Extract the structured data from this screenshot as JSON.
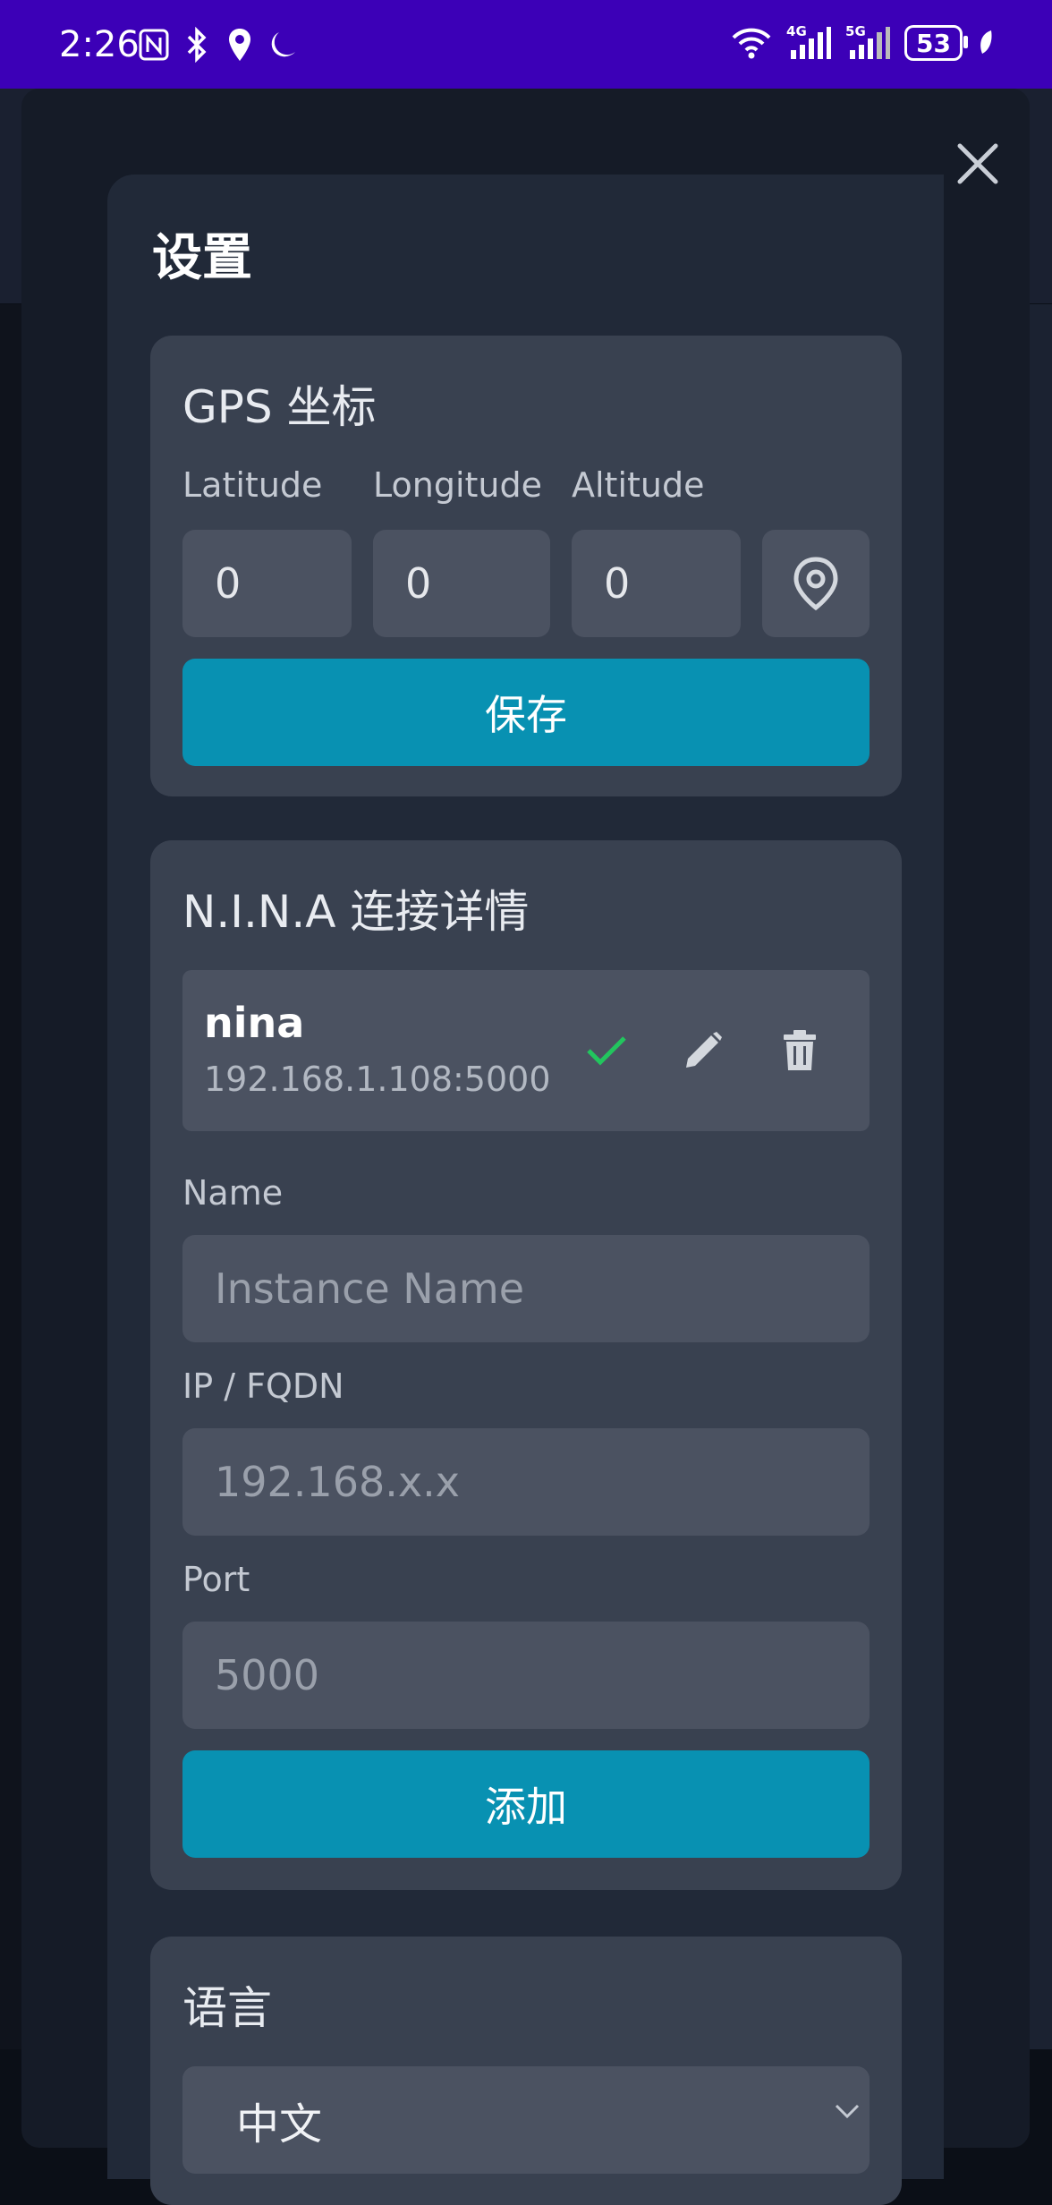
{
  "status_bar": {
    "time": "2:26",
    "battery": "53",
    "net_4g": "4G",
    "net_5g": "5G"
  },
  "modal": {
    "title": "设置",
    "gps": {
      "title": "GPS 坐标",
      "latitude_label": "Latitude",
      "longitude_label": "Longitude",
      "altitude_label": "Altitude",
      "latitude_value": "0",
      "longitude_value": "0",
      "altitude_value": "0",
      "save_label": "保存"
    },
    "nina": {
      "title": "N.I.N.A 连接详情",
      "connections": [
        {
          "name": "nina",
          "address": "192.168.1.108:5000"
        }
      ],
      "name_label": "Name",
      "name_placeholder": "Instance Name",
      "ip_label": "IP / FQDN",
      "ip_placeholder": "192.168.x.x",
      "port_label": "Port",
      "port_placeholder": "5000",
      "add_label": "添加"
    },
    "language": {
      "title": "语言",
      "selected": "中文"
    }
  },
  "colors": {
    "status_bar": "#3c00b7",
    "modal_bg": "#212938",
    "card_bg": "#394150",
    "field_bg": "#4b5261",
    "primary": "#0891b2",
    "check": "#22c55e"
  },
  "icons": [
    "wifi-icon",
    "signal-icon",
    "nfc-icon",
    "bluetooth-icon",
    "location-icon",
    "moon-icon",
    "close-icon",
    "map-pin-icon",
    "check-icon",
    "pencil-icon",
    "trash-icon",
    "chevron-down-icon",
    "leaf-icon"
  ]
}
